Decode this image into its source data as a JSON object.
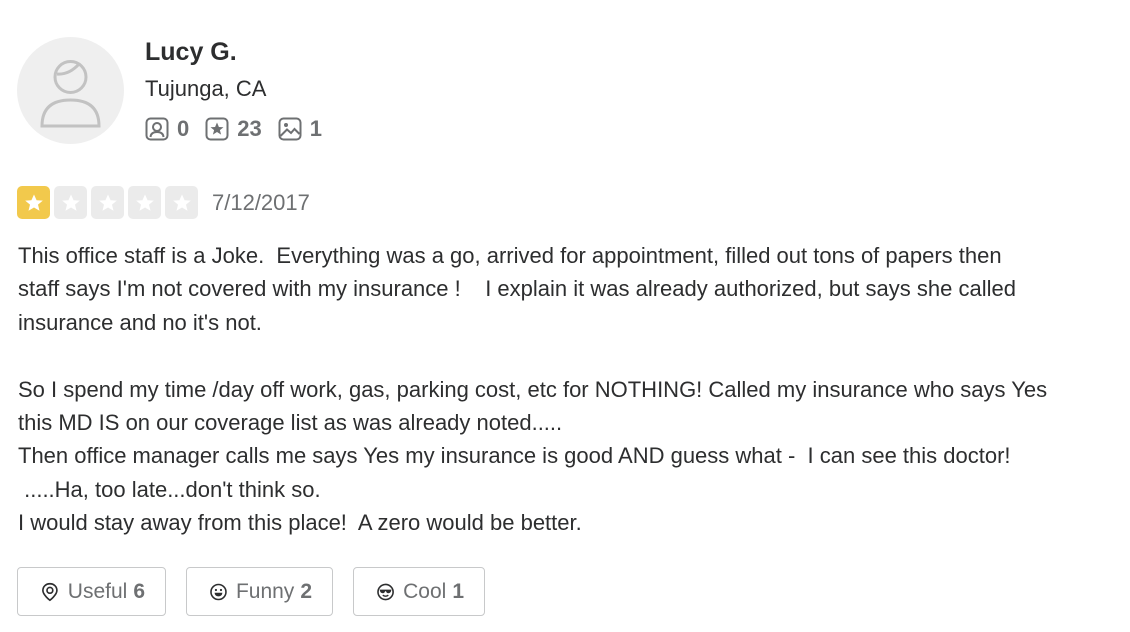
{
  "user": {
    "name": "Lucy G.",
    "location": "Tujunga, CA",
    "stats": [
      {
        "icon": "friends-icon",
        "value": "0"
      },
      {
        "icon": "review-star-icon",
        "value": "23"
      },
      {
        "icon": "photo-icon",
        "value": "1"
      }
    ]
  },
  "review": {
    "rating": 1,
    "max_rating": 5,
    "date": "7/12/2017",
    "lines": [
      "This office staff is a Joke.  Everything was a go, arrived for appointment, filled out tons of papers then",
      "staff says I'm not covered with my insurance !    I explain it was already authorized, but says she called",
      "insurance and no it's not.",
      "",
      "So I spend my time /day off work, gas, parking cost, etc for NOTHING! Called my insurance who says Yes",
      "this MD IS on our coverage list as was already noted.....",
      "Then office manager calls me says Yes my insurance is good AND guess what -  I can see this doctor!",
      " .....Ha, too late...don't think so.",
      "I would stay away from this place!  A zero would be better."
    ]
  },
  "reactions": [
    {
      "icon": "useful-icon",
      "label": "Useful",
      "count": "6"
    },
    {
      "icon": "funny-icon",
      "label": "Funny",
      "count": "2"
    },
    {
      "icon": "cool-icon",
      "label": "Cool",
      "count": "1"
    }
  ],
  "colors": {
    "star_filled": "#f2c94c",
    "star_empty": "#ebebeb",
    "text": "#2d2e2f",
    "muted": "#6e7072"
  }
}
